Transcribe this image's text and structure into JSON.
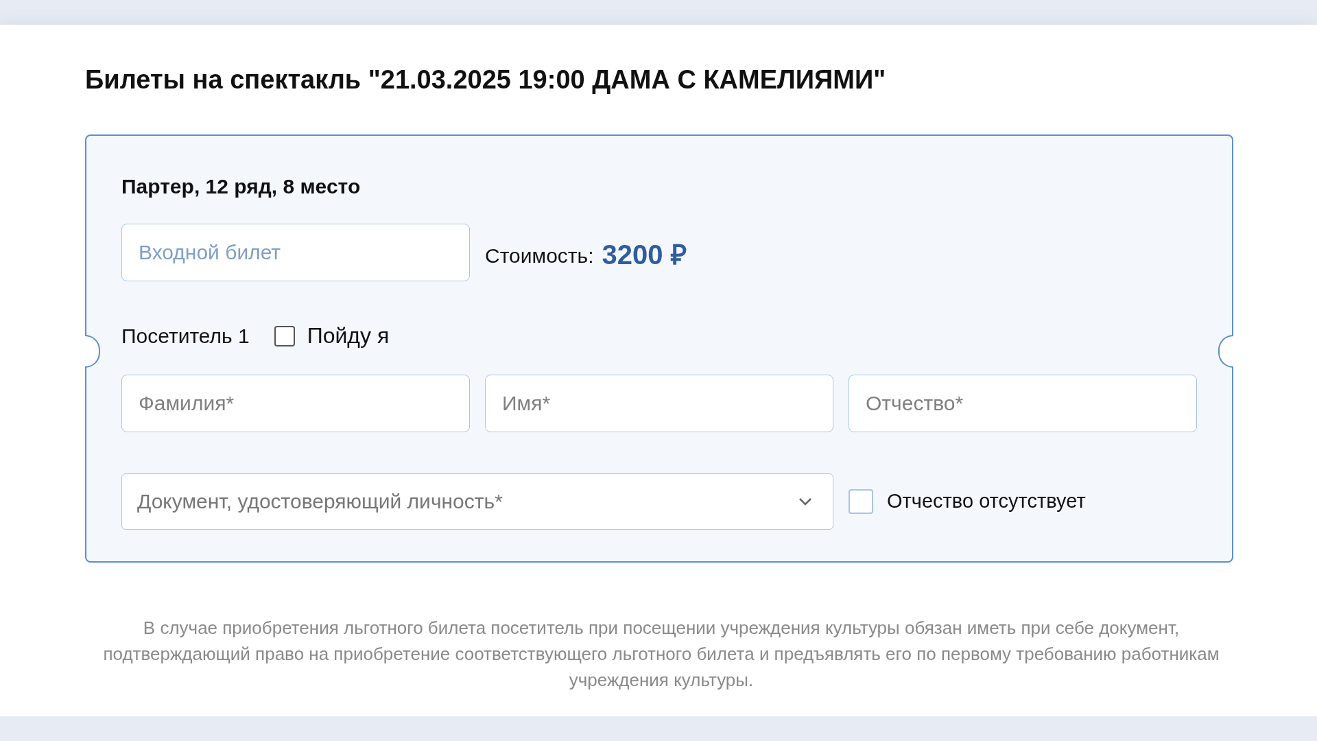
{
  "title": "Билеты на спектакль \"21.03.2025 19:00 ДАМА С КАМЕЛИЯМИ\"",
  "ticket": {
    "seat": "Партер, 12 ряд, 8 место",
    "ticket_type": {
      "placeholder": "Входной билет"
    },
    "cost_label": "Стоимость:",
    "cost_value": "3200 ₽",
    "visitor": {
      "label": "Посетитель 1",
      "self_checkbox": {
        "label": "Пойду я",
        "checked": false
      }
    },
    "name_fields": [
      {
        "placeholder": "Фамилия*"
      },
      {
        "placeholder": "Имя*"
      },
      {
        "placeholder": "Отчество*"
      }
    ],
    "document_select": {
      "placeholder": "Документ, удостоверяющий личность*"
    },
    "no_patronymic_checkbox": {
      "label": "Отчество отсутствует",
      "checked": false
    }
  },
  "notice": "В случае приобретения льготного билета посетитель при посещении учреждения культуры обязан иметь при себе документ, подтверждающий право на приобретение соответствующего льготного билета и предъявлять его по первому требованию работникам учреждения культуры."
}
